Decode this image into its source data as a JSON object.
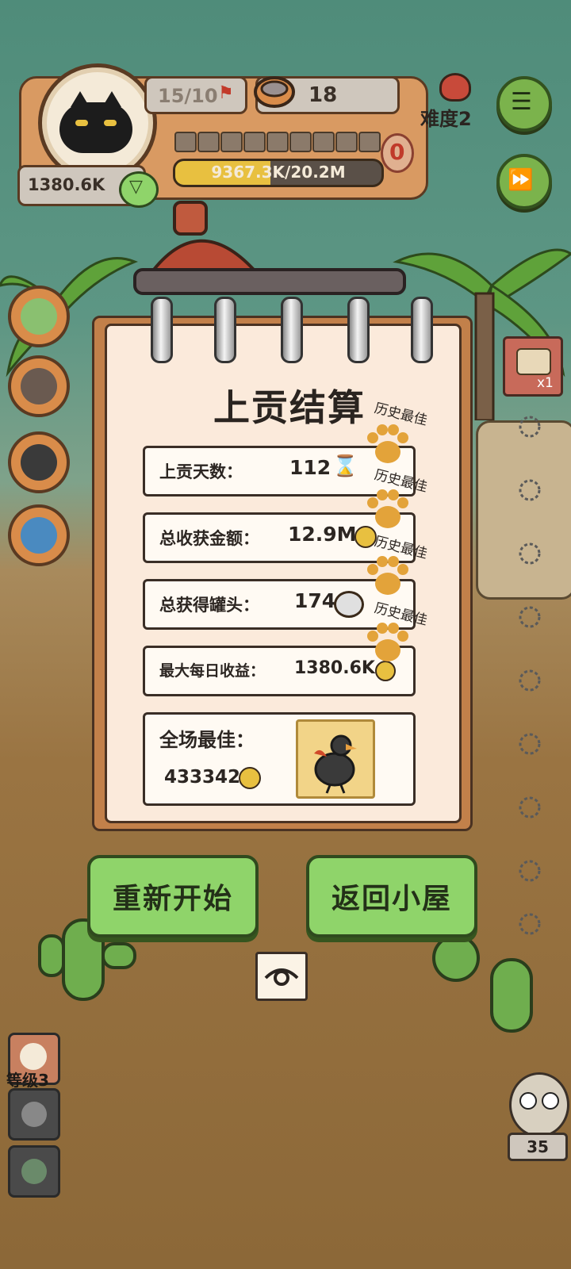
{
  "hud": {
    "level_progress": "15/10",
    "cans_count": "18",
    "difficulty": "难度2",
    "income": "1380.6K",
    "progress_zero": "0",
    "gold_progress": "9367.3K/20.2M",
    "gold_fill": 0.46
  },
  "side_badge": "x1",
  "summary": {
    "title": "上贡结算",
    "best_label": "历史最佳",
    "rows": [
      {
        "label": "上贡天数：",
        "value": "112"
      },
      {
        "label": "总收获金额：",
        "value": "12.9M"
      },
      {
        "label": "总获得罐头：",
        "value": "174"
      },
      {
        "label": "最大每日收益：",
        "value": "1380.6K"
      }
    ],
    "mvp_label": "全场最佳：",
    "mvp_value": "433342"
  },
  "buttons": {
    "restart": "重新开始",
    "back_home": "返回小屋"
  },
  "bottom": {
    "level_label": "等级3",
    "counter": "35"
  },
  "colors": {
    "green_button": "#8fd46a",
    "paper": "#fbeadb",
    "paw": "#e3a33a"
  }
}
